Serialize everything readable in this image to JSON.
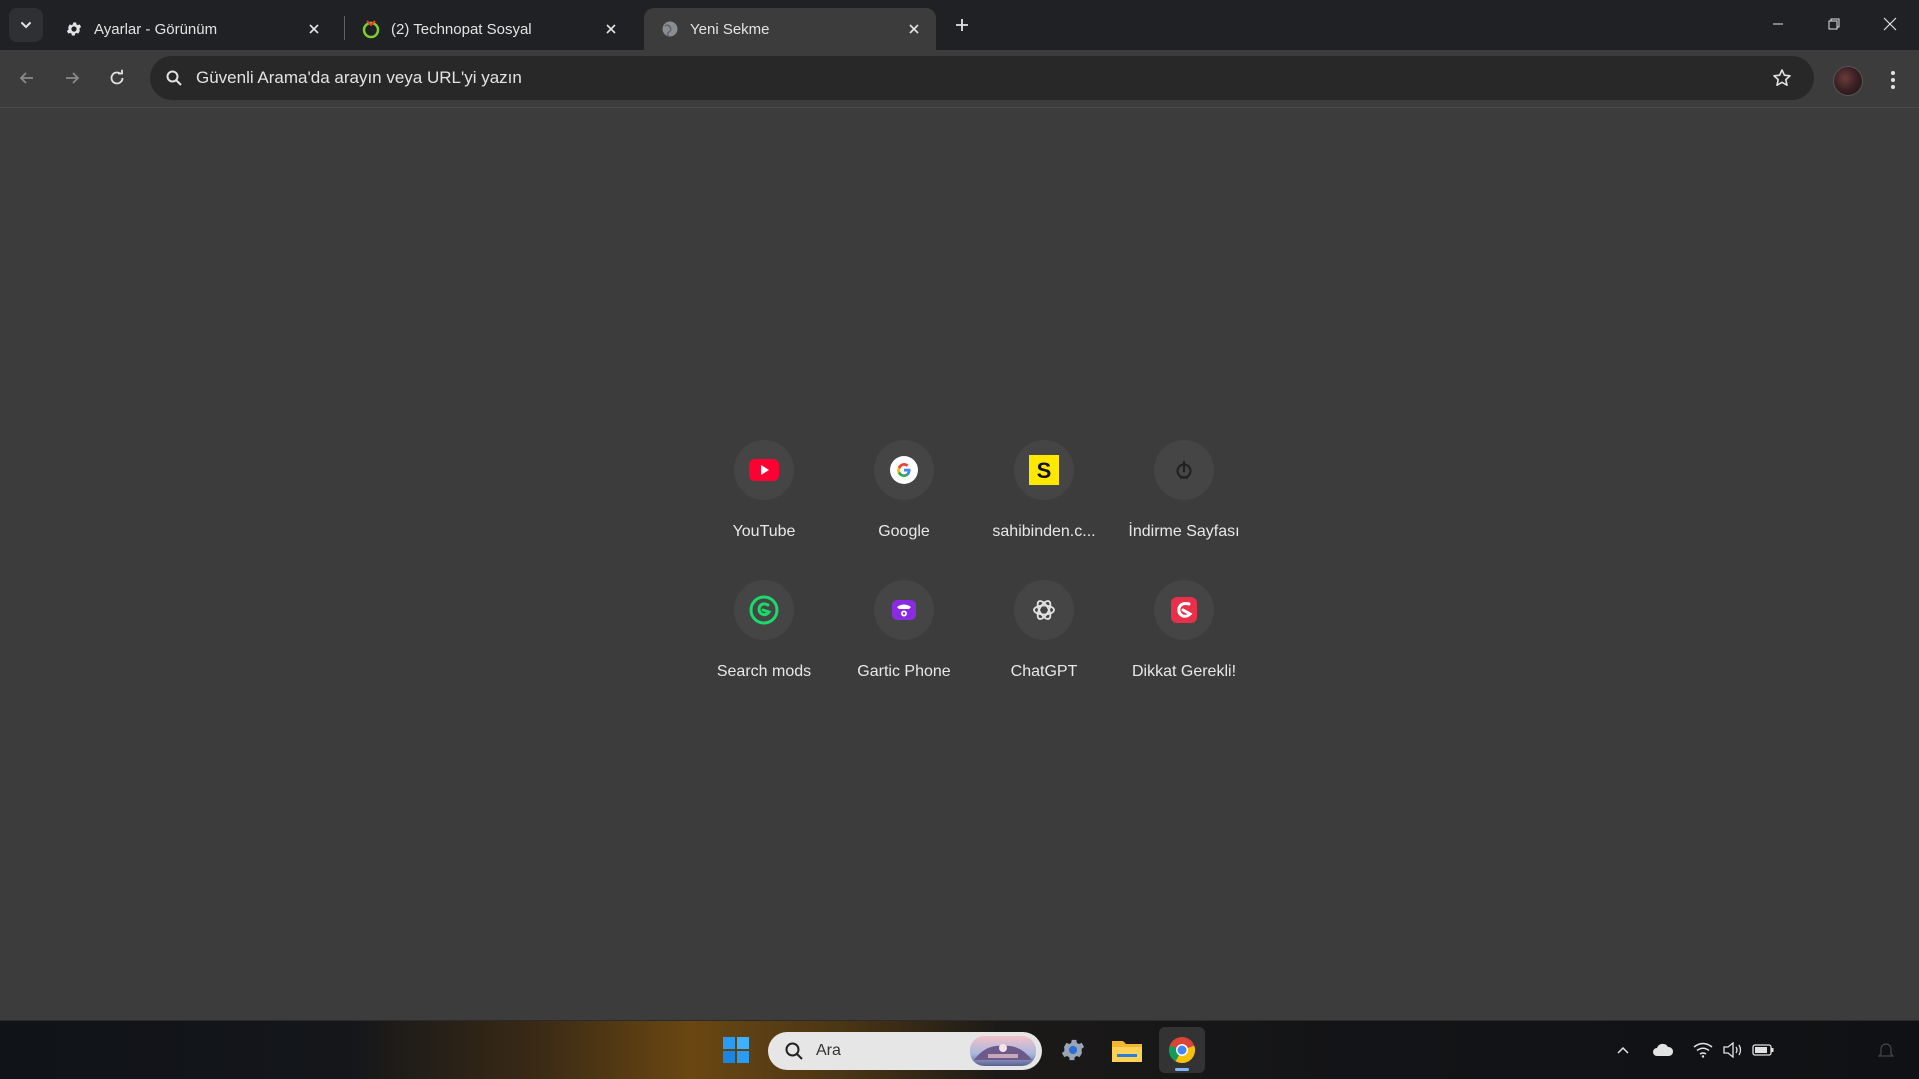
{
  "tabs": [
    {
      "title": "Ayarlar - Görünüm",
      "icon": "gear-icon",
      "active": false
    },
    {
      "title": "(2) Technopat Sosyal",
      "icon": "technopat-icon",
      "active": false
    },
    {
      "title": "Yeni Sekme",
      "icon": "globe-icon",
      "active": true
    }
  ],
  "omnibox": {
    "placeholder": "Güvenli Arama'da arayın veya URL'yi yazın"
  },
  "shortcuts": [
    {
      "label": "YouTube",
      "icon": "youtube-icon"
    },
    {
      "label": "Google",
      "icon": "google-icon"
    },
    {
      "label": "sahibinden.c...",
      "icon": "sahibinden-icon"
    },
    {
      "label": "İndirme Sayfası",
      "icon": "download-page-icon"
    },
    {
      "label": "Search mods",
      "icon": "search-mods-icon"
    },
    {
      "label": "Gartic Phone",
      "icon": "gartic-phone-icon"
    },
    {
      "label": "ChatGPT",
      "icon": "chatgpt-icon"
    },
    {
      "label": "Dikkat Gerekli!",
      "icon": "attention-icon"
    }
  ],
  "taskbar": {
    "search_text": "Ara",
    "apps": [
      "windows-start-icon",
      "settings-icon",
      "file-explorer-icon",
      "chrome-icon"
    ]
  },
  "colors": {
    "background": "#3c3c3c",
    "tabstrip": "#202124",
    "omnibox": "#282828",
    "tile": "#454545",
    "youtube_red": "#ff0033",
    "sahibinden_yellow": "#ffe800",
    "gartic_purple": "#8a2be2",
    "search_mods_green": "#1bd96a",
    "attention_red": "#e8304a"
  }
}
